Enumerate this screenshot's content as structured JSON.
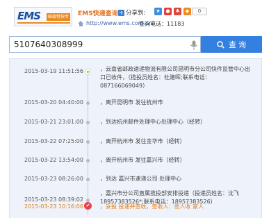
{
  "header": {
    "logo_text": "EMS",
    "logo_subtitle": "邮政特快专递",
    "title": "EMS快递查询",
    "share_label": "分享到:",
    "share_icons": [
      "qzone-icon",
      "weibo-icon",
      "renren-icon",
      "kaixin-icon",
      "douban-icon"
    ],
    "share_count": "0",
    "url": "http://www.ems.com.cn/",
    "phone": "查询电话：11183"
  },
  "search": {
    "value": "5107640308999",
    "button_label": "查 询"
  },
  "tracking": [
    {
      "time": "2015-03-19 11:51:56",
      "desc": "，云南省邮政速递物流有限公司昆明市分公司快件监管中心出口已收件，（揽投员姓名：杜建晖;联系电话：087166069049）"
    },
    {
      "time": "2015-03-20 04:40:00",
      "desc": "，离开昆明市 发往杭州市"
    },
    {
      "time": "2015-03-21 23:01:00",
      "desc": "，到达杭州邮件处理中心处理中心（经转）"
    },
    {
      "time": "2015-03-22 07:25:00",
      "desc": "，离开杭州市 发往金华市（经转）"
    },
    {
      "time": "2015-03-22 13:54:00",
      "desc": "，离开杭州市 发往嘉兴市（经转）"
    },
    {
      "time": "2015-03-23 08:26:00",
      "desc": "，到达 嘉兴市速递公司 处理中心"
    },
    {
      "time": "2015-03-23 08:39:02",
      "desc": "，嘉兴市分公司直属揽投部安排投递（投递员姓名：沈飞18957383526*;联系电话：18957383526）"
    },
    {
      "time": "2015-03-23 10:16:06",
      "desc": "，妥投 投递并签收，签收人：他人收 家人"
    }
  ]
}
